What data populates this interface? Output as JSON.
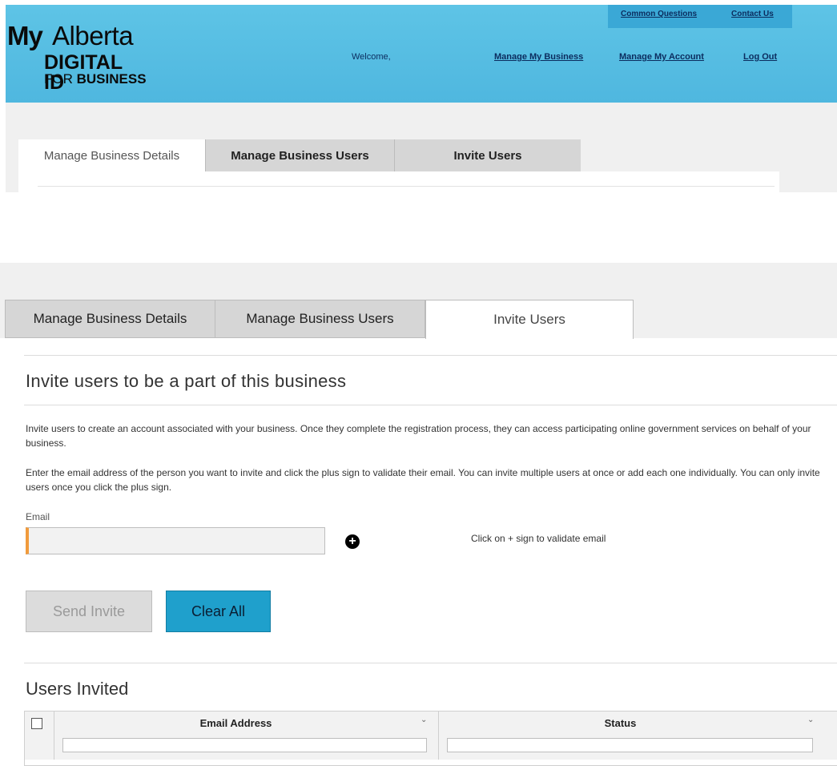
{
  "header": {
    "brand": {
      "my": "My",
      "alberta": "Alberta",
      "digital_id": "DIGITAL ID",
      "for": "FOR",
      "business": "BUSINESS"
    },
    "top_links": {
      "common_questions": "Common Questions",
      "contact_us": "Contact Us"
    },
    "welcome": "Welcome,",
    "nav": {
      "manage_business": "Manage My Business",
      "manage_account": "Manage My Account",
      "log_out": "Log Out"
    }
  },
  "tabs": {
    "details": "Manage Business Details",
    "users": "Manage Business Users",
    "invite": "Invite Users"
  },
  "invite": {
    "title": "Invite users to be a part of this business",
    "para1": "Invite users to create an account associated with your business. Once they complete the registration process, they can access participating online government services on behalf of your business.",
    "para2": "Enter the email address of the person you want to invite and click the plus sign to validate their email. You can invite multiple users at once or add each one individually. You can only invite users once you click the plus sign.",
    "email_label": "Email",
    "email_value": "",
    "plus_symbol": "+",
    "hint": "Click on + sign to validate email",
    "send_button": "Send Invite",
    "clear_button": "Clear All"
  },
  "users_invited": {
    "title": "Users Invited",
    "columns": [
      "Email Address",
      "Status"
    ],
    "rows": []
  },
  "colors": {
    "header_bg": "#55bde3",
    "accent_orange": "#f19b3c",
    "button_blue": "#1fa0cc",
    "tab_inactive": "#d6d6d6"
  },
  "icons": {
    "plus": "plus-circle-icon",
    "chevron": "chevron-down-icon"
  }
}
